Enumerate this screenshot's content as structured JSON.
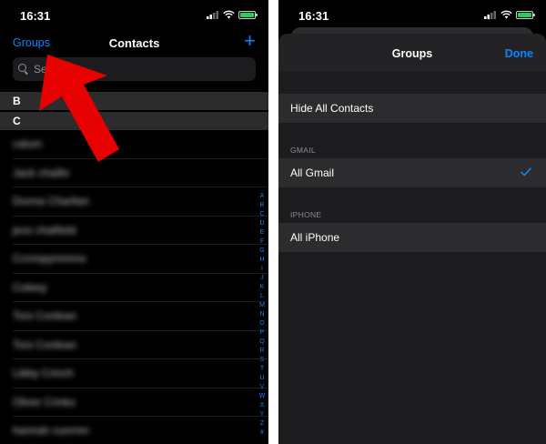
{
  "left_screen": {
    "status_time": "16:31",
    "nav": {
      "groups_label": "Groups",
      "title": "Contacts",
      "add_label": "+"
    },
    "search": {
      "placeholder": "Search",
      "value": ""
    },
    "sections": [
      "B",
      "C"
    ],
    "contacts": [
      "calum",
      "Jack chaillo",
      "Donna Chartlan",
      "jess chatfield",
      "Ccnmpymmmo",
      "Coleey",
      "Toni Conlean",
      "Toni Conlean",
      "Libby Crinch",
      "Oliver Crinks",
      "hannah cuorren"
    ],
    "index_letters": [
      "A",
      "B",
      "C",
      "D",
      "E",
      "F",
      "G",
      "H",
      "I",
      "J",
      "K",
      "L",
      "M",
      "N",
      "O",
      "P",
      "Q",
      "R",
      "S",
      "T",
      "U",
      "V",
      "W",
      "X",
      "Y",
      "Z",
      "#"
    ]
  },
  "right_screen": {
    "status_time": "16:31",
    "sheet": {
      "title": "Groups",
      "done_label": "Done"
    },
    "hide_all_label": "Hide All Contacts",
    "groups": [
      {
        "section": "GMAIL",
        "name": "All Gmail",
        "selected": true
      },
      {
        "section": "IPHONE",
        "name": "All iPhone",
        "selected": false
      }
    ]
  },
  "colors": {
    "accent": "#0a84ff",
    "background": "#000000",
    "row_background": "#2c2c2e",
    "annotation_arrow": "#e60000",
    "battery": "#34c759"
  },
  "icons": {
    "status": [
      "signal-icon",
      "wifi-icon",
      "battery-icon"
    ],
    "search": "search-icon",
    "selected": "checkmark-icon"
  }
}
